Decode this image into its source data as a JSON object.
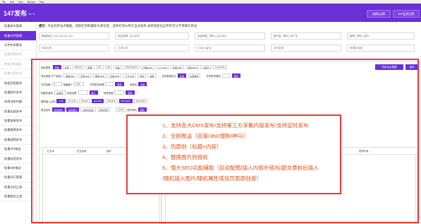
{
  "menu": {
    "items": [
      "File",
      "Edit",
      "View",
      "Window",
      "Help"
    ]
  },
  "app": {
    "title": "147发布",
    "version": "v1.0.3"
  },
  "top_buttons": {
    "qq": "加群QQ群",
    "vip": "VIP会员注册"
  },
  "sidebar": {
    "items": [
      {
        "label": "批量发布管理"
      },
      {
        "label": "批量文件管理"
      },
      {
        "label": "文件夹采集发"
      },
      {
        "label": "批量采集发布"
      },
      {
        "label": "关键词批量发"
      },
      {
        "label": "批量内容发布"
      },
      {
        "label": "按类型批量发"
      },
      {
        "label": "批量图片发布"
      },
      {
        "label": "伪原创发布器"
      },
      {
        "label": "批量友链发布"
      },
      {
        "label": "批量链接发布"
      },
      {
        "label": "批量替换发布"
      },
      {
        "label": "批量视频发布"
      },
      {
        "label": "批量API推送"
      },
      {
        "label": "批量标签发布"
      },
      {
        "label": "批量360推送"
      },
      {
        "label": "批量运行管理"
      },
      {
        "label": "批量全站工具"
      },
      {
        "label": "批量服务工具"
      }
    ]
  },
  "hint": {
    "prefix": "提示:",
    "text": "点击同步站点数据，获取栏目和最新文章信息，选择栏目ID用于自动发布,未修改后台自带的可以不用填写目录"
  },
  "form": {
    "url_label": "网站地址",
    "url_value": "www.domain.com",
    "site_label": "站点名称",
    "site_placeholder": "站点名称",
    "login_label": "后台地址",
    "login_placeholder": "请输入后台地址",
    "user_label": "用户名",
    "user_placeholder": "请输入用户名",
    "pass_label": "密码",
    "pass_placeholder": "请输入密码",
    "r2": [
      "网站目录",
      "文章目录",
      "栏目ID(留空)",
      "发布密钥",
      "数据库前缀",
      "图片目录"
    ]
  },
  "panel": {
    "cms_label": "网站类型:",
    "cms": [
      "帝国",
      "织梦",
      "ZBLOG",
      "苹果",
      "WP",
      "PB",
      "迅睿",
      "PHPCMSV9",
      "帝国CMS",
      "人人CMS",
      "米拓CMS",
      "易优CMS",
      "小旋风",
      "ThinkCMF"
    ],
    "sync_btn": "同步站点数据",
    "save_btn": "保存",
    "r2_label": "同步类型(下个版本):",
    "r2": [
      "播放ABC",
      "无缝CMS",
      "黑金CMS",
      "迅睿CMS",
      "飞飞CMS",
      "米粒",
      "搜索"
    ],
    "r2b_label": "定时更新执行",
    "r2b": [
      "文章",
      "文章随机"
    ],
    "r2c_label": "文章发布随机",
    "r3_label": "文件标题",
    "r3": [
      "5",
      "每篇最少",
      "100"
    ],
    "r3b": "文章发布间隔",
    "r3c": "伪原创",
    "r4_label": "标题关键词",
    "r4": [
      "关键词",
      "标签设置",
      "插入",
      "标签前缀"
    ],
    "r5_label": "随机插入比例",
    "r5": [
      "1-30",
      "20-100",
      "50-200",
      "100-500",
      "200-800",
      "500-1000",
      "100-1500"
    ],
    "r6_label": "是否发布",
    "r6": [
      "启用发布",
      "发布图片",
      "伪原创设置",
      "添加目录"
    ],
    "r6b": [
      "24:00",
      "发布时间",
      "保存"
    ]
  },
  "table_left": {
    "headers": [
      "栏目ID",
      "栏目名称",
      "操作",
      "是否启用"
    ]
  },
  "table_right": {
    "headers": [
      "文章ID",
      "标题",
      "作者",
      "发布时间"
    ]
  },
  "callout": {
    "lines": [
      "1、支持各大CMS发布/支持第三方采集内容发布/支持定时发布",
      "2、全网推送（百度/360/搜狗/神马）",
      "3、伪原创（标题+内容）",
      "4、替换图片防授权",
      "5、强大SEO功能辅助（自动配图/插入内链外链/标题文章前后插入",
      "/随机插入图片/随机属性增加页面原创度）"
    ]
  },
  "colors": {
    "brand": "#6a2fd6",
    "callout_border": "#e83b3b",
    "callout_text": "#e34e12"
  }
}
